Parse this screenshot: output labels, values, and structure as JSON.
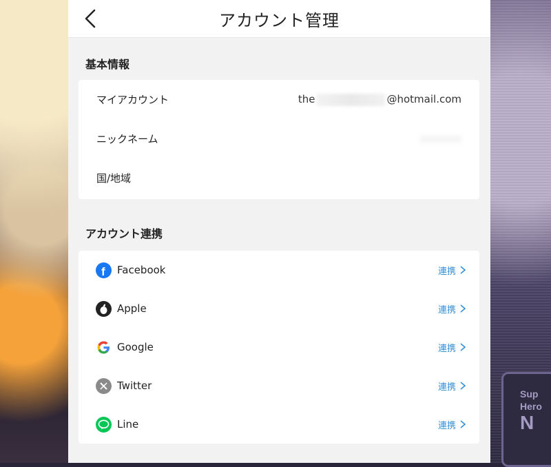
{
  "header": {
    "title": "アカウント管理"
  },
  "basic": {
    "section_title": "基本情報",
    "rows": [
      {
        "label": "マイアカウント",
        "value_prefix": "the",
        "value_suffix": "@hotmail.com"
      },
      {
        "label": "ニックネーム"
      },
      {
        "label": "国/地域"
      }
    ]
  },
  "linking": {
    "section_title": "アカウント連携",
    "items": [
      {
        "label": "Facebook",
        "action": "連携",
        "icon": "facebook-icon",
        "color": "#1877f2"
      },
      {
        "label": "Apple",
        "action": "連携",
        "icon": "apple-icon",
        "color": "#222222"
      },
      {
        "label": "Google",
        "action": "連携",
        "icon": "google-icon",
        "color": "#4285f4"
      },
      {
        "label": "Twitter",
        "action": "連携",
        "icon": "x-icon",
        "color": "#8a8a8a"
      },
      {
        "label": "Line",
        "action": "連携",
        "icon": "line-icon",
        "color": "#06c755"
      }
    ]
  },
  "background_sign": {
    "line1": "Sup",
    "line2": "Hero",
    "line3": "N"
  },
  "colors": {
    "accent": "#3a8fd8",
    "panel_bg": "#f2f2f2"
  }
}
